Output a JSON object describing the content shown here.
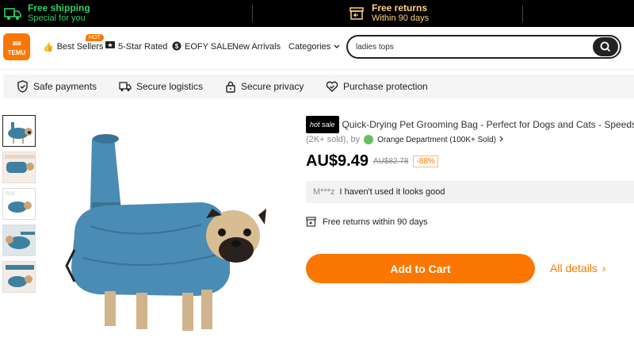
{
  "promo": {
    "shipping_title": "Free shipping",
    "shipping_sub": "Special for you",
    "returns_title": "Free returns",
    "returns_sub": "Within 90 days"
  },
  "header": {
    "logo_text": "TEMU",
    "hot_badge": "HOT",
    "nav": [
      {
        "label": "Best Sellers",
        "icon": "thumbs-up-icon"
      },
      {
        "label": "5-Star Rated",
        "icon": "star-icon"
      },
      {
        "label": "EOFY SALE",
        "icon": "dollar-icon"
      },
      {
        "label": "New Arrivals",
        "icon": ""
      },
      {
        "label": "Categories",
        "icon": "chevron-down-icon"
      }
    ],
    "search_value": "ladies tops"
  },
  "trust": [
    {
      "label": "Safe payments",
      "icon": "shield-check-icon"
    },
    {
      "label": "Secure logistics",
      "icon": "truck-icon"
    },
    {
      "label": "Secure privacy",
      "icon": "lock-icon"
    },
    {
      "label": "Purchase protection",
      "icon": "protection-icon"
    }
  ],
  "product": {
    "badge": "hot sale",
    "title": "Quick-Drying Pet Grooming Bag - Perfect for Dogs and Cats - Speeds Up",
    "sold": "(2K+ sold), by",
    "store": "Orange Department (100K+ Sold)",
    "price": "AU$9.49",
    "original_price": "AU$82.78",
    "discount": "-88%",
    "review_user": "M***z",
    "review_text": "I haven't used it looks good",
    "returns_text": "Free returns within 90 days",
    "add_to_cart": "Add to Cart",
    "all_details": "All details"
  },
  "colors": {
    "accent": "#fb7701",
    "promo_green": "#2fcf6a",
    "promo_gold": "#ffd27a"
  }
}
